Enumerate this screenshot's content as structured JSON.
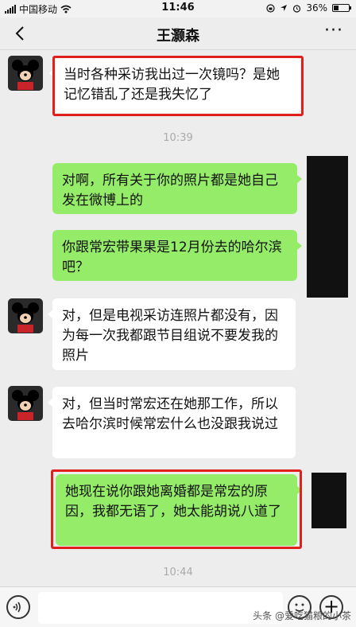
{
  "status_bar": {
    "carrier": "中国移动",
    "time": "11:46",
    "battery": "36%",
    "battery_level": 0.36
  },
  "nav": {
    "title": "王灏森",
    "more_label": "···"
  },
  "messages": [
    {
      "side": "left",
      "text": "当时各种采访我出过一次镜吗？是她记忆错乱了还是我失忆了"
    },
    {
      "type": "time",
      "text": "10:39"
    },
    {
      "side": "right",
      "text": "对啊，所有关于你的照片都是她自己发在微博上的"
    },
    {
      "side": "right",
      "text": "你跟常宏带果果是12月份去的哈尔滨吧？"
    },
    {
      "side": "left",
      "text": "对，但是电视采访连照片都没有，因为每一次我都跟节目组说不要发我的照片"
    },
    {
      "side": "left",
      "text": "对，但当时常宏还在她那工作，所以去哈尔滨时候常宏什么也没跟我说过"
    },
    {
      "side": "right",
      "text": "她现在说你跟她离婚都是常宏的原因，我都无语了，她太能胡说八道了"
    },
    {
      "type": "time",
      "text": "10:44"
    }
  ],
  "input_bar": {
    "plus_label": "+"
  },
  "watermark": "头条 @爱吃猫粮的小茶"
}
